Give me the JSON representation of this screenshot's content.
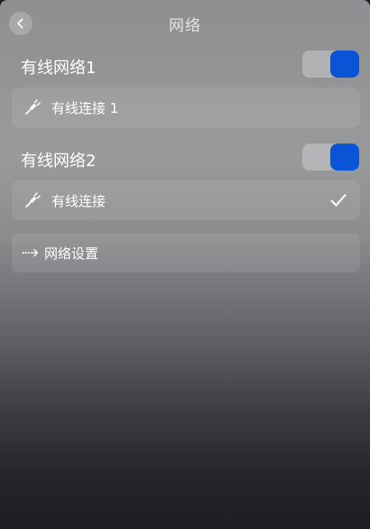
{
  "header": {
    "title": "网络",
    "back_icon": "chevron-left-icon"
  },
  "sections": [
    {
      "title": "有线网络1",
      "toggle_on": true,
      "connection": {
        "label": "有线连接 1",
        "icon": "ethernet-plug-icon",
        "connected": false
      }
    },
    {
      "title": "有线网络2",
      "toggle_on": true,
      "connection": {
        "label": "有线连接",
        "icon": "ethernet-plug-icon",
        "connected": true
      }
    }
  ],
  "settings_link": {
    "label": "网络设置",
    "icon": "dotted-arrow-right-icon"
  },
  "colors": {
    "accent": "#0a55d6",
    "text": "#ffffff"
  }
}
